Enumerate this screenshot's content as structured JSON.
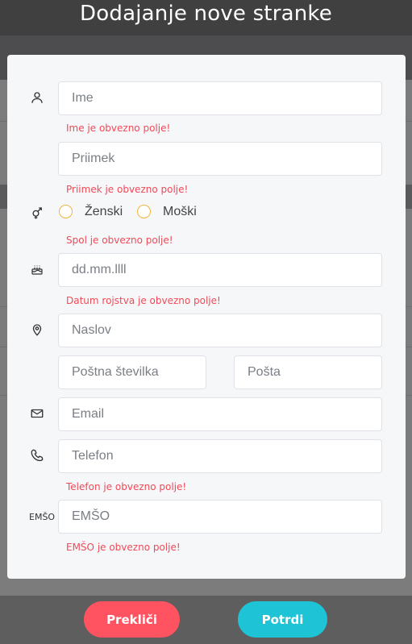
{
  "page_title": "Dodajanje nove stranke",
  "form": {
    "ime": {
      "placeholder": "Ime",
      "error": "Ime je obvezno polje!"
    },
    "priimek": {
      "placeholder": "Priimek",
      "error": "Priimek je obvezno polje!"
    },
    "spol": {
      "options": [
        "Ženski",
        "Moški"
      ],
      "error": "Spol je obvezno polje!"
    },
    "datum_rojstva": {
      "placeholder": "dd.mm.llll",
      "error": "Datum rojstva je obvezno polje!"
    },
    "naslov": {
      "placeholder": "Naslov"
    },
    "postna_stevilka": {
      "placeholder": "Poštna številka"
    },
    "posta": {
      "placeholder": "Pošta"
    },
    "email": {
      "placeholder": "Email"
    },
    "telefon": {
      "placeholder": "Telefon",
      "error": "Telefon je obvezno polje!"
    },
    "emso": {
      "label": "EMŠO",
      "placeholder": "EMŠO",
      "error": "EMŠO je obvezno polje!"
    }
  },
  "icons": {
    "ime": "user-icon",
    "spol": "gender-icon",
    "datum_rojstva": "birthday-cake-icon",
    "naslov": "location-pin-icon",
    "email": "envelope-icon",
    "telefon": "phone-icon"
  },
  "buttons": {
    "cancel_label": "Prekliči",
    "confirm_label": "Potrdi"
  },
  "colors": {
    "error": "#f04a58",
    "radio_border": "#f0b43a",
    "cancel": "#ff5361",
    "confirm": "#1ec3d6"
  }
}
